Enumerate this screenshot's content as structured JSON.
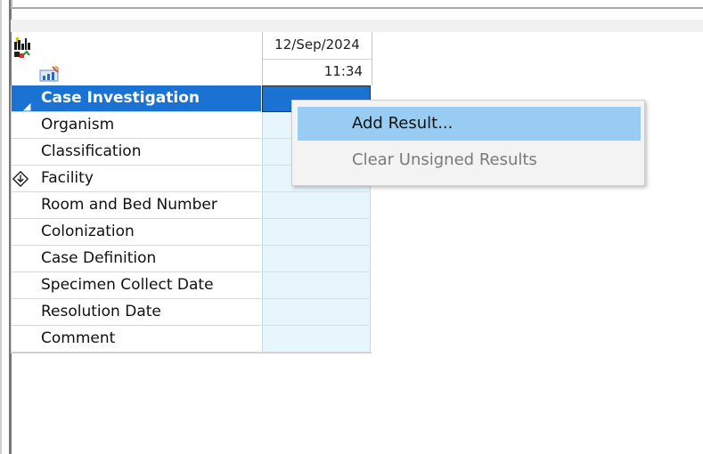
{
  "grid": {
    "column": {
      "date": "12/Sep/2024",
      "time": "11:34"
    },
    "rows": [
      {
        "label": "Case Investigation"
      },
      {
        "label": "Organism"
      },
      {
        "label": "Classification"
      },
      {
        "label": "Facility"
      },
      {
        "label": "Room and Bed Number"
      },
      {
        "label": "Colonization"
      },
      {
        "label": "Case Definition"
      },
      {
        "label": "Specimen Collect Date"
      },
      {
        "label": "Resolution Date"
      },
      {
        "label": "Comment"
      }
    ]
  },
  "context_menu": {
    "items": [
      {
        "label": "Add Result...",
        "state": "highlighted"
      },
      {
        "label": "Clear Unsigned Results",
        "state": "disabled"
      }
    ]
  },
  "colors": {
    "selection": "#1a73d2",
    "cell_bg": "#e7f6fd",
    "menu_highlight": "#99ccf2"
  },
  "icons": [
    "results-chart-icon",
    "expand-collapse-triangle-icon",
    "facility-location-icon"
  ]
}
